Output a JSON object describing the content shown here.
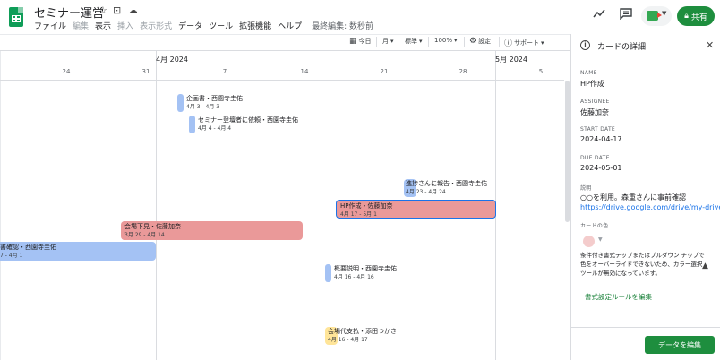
{
  "app": {
    "doc_title": "セミナー運営",
    "icons": [
      "star-icon",
      "move-folder-icon",
      "cloud-status-icon"
    ],
    "menu": [
      "ファイル",
      "編集",
      "表示",
      "挿入",
      "表示形式",
      "データ",
      "ツール",
      "拡張機能",
      "ヘルプ"
    ],
    "disabled_menu": [
      "編集",
      "挿入",
      "表示形式"
    ],
    "last_edit": "最終編集: 数秒前",
    "share_label": "共有"
  },
  "toolbar": {
    "today": "今日",
    "period": "月",
    "mode": "標準",
    "zoom": "100%",
    "settings": "設定",
    "support": "サポート"
  },
  "timeline": {
    "months": [
      "4月 2024",
      "5月 2024"
    ],
    "days": [
      "24",
      "31",
      "7",
      "14",
      "21",
      "28",
      "5"
    ],
    "cards": [
      {
        "title": "企画書・西園寺圭佑",
        "dates": "4月 3 - 4月 3",
        "color": "#a4c2f4"
      },
      {
        "title": "セミナー登壇者に依頼・西園寺圭佑",
        "dates": "4月 4 - 4月 4",
        "color": "#a4c2f4"
      },
      {
        "title": "進捗さんに報告・西園寺圭佑",
        "dates": "4月 23 - 4月 24",
        "color": "#a4c2f4"
      },
      {
        "title": "HP作成・佐藤加奈",
        "dates": "4月 17 - 5月 1",
        "color": "#ea9999",
        "selected": true
      },
      {
        "title": "会場下見・佐藤加奈",
        "dates": "3月 29 - 4月 14",
        "color": "#ea9999"
      },
      {
        "title": "書確認・西園寺圭佑",
        "dates": "7 - 4月 1",
        "color": "#a4c2f4"
      },
      {
        "title": "概要説明・西園寺圭佑",
        "dates": "4月 16 - 4月 16",
        "color": "#a4c2f4"
      },
      {
        "title": "会場代支払・添田つかさ",
        "dates": "4月 16 - 4月 17",
        "color": "#ffe599"
      }
    ]
  },
  "panel": {
    "title": "カードの詳細",
    "name_label": "NAME",
    "name": "HP作成",
    "assignee_label": "ASSIGNEE",
    "assignee": "佐藤加奈",
    "start_label": "START DATE",
    "start": "2024-04-17",
    "due_label": "DUE DATE",
    "due": "2024-05-01",
    "desc_label": "説明",
    "desc_text": "○○を利用。森重さんに事前確認",
    "desc_link": "https://drive.google.com/drive/my-drive",
    "color_label": "カードの色",
    "color_value": "#f4cccc",
    "warning": "条件付き書式テップまたはプルダウン チップで色をオーバーライドできないため、カラー選択ツールが無効になっています。",
    "rule_link": "書式設定ルールを編集",
    "edit_button": "データを編集"
  }
}
